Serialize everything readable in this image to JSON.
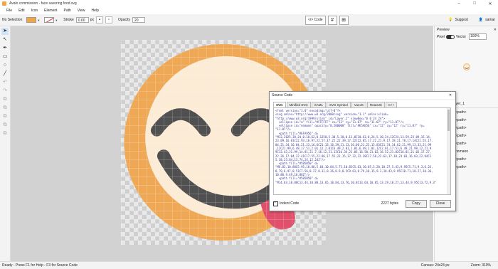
{
  "window": {
    "title": "Avalo commission - face savoring food.svg"
  },
  "menu": [
    "File",
    "Edit",
    "Icon",
    "Element",
    "Path",
    "View",
    "Help"
  ],
  "toolbar": {
    "selection": "No Selection",
    "stroke_label": "Stroke",
    "stroke_value": "0.00",
    "px": "px",
    "opacity_label": "Opacity",
    "opacity_value": "20",
    "code_label": "Code",
    "suggest_label": "Suggest",
    "user_label": "samar"
  },
  "preview": {
    "title": "Preview",
    "pixel_label": "Pixel",
    "vector_label": "Vector",
    "zoom": "100%"
  },
  "tree": {
    "header": "Layer_1",
    "rows": [
      "<path>",
      "<path>",
      "<path>",
      "<path>",
      "<path>",
      "nomano",
      "<path>",
      "<path>"
    ]
  },
  "dialog": {
    "title": "Source Code",
    "tabs": [
      "SVG",
      "Minified SVG",
      "XAML",
      "SVG Symbol",
      "VueJS",
      "ReactJS",
      "C++"
    ],
    "code_lines": [
      "<?xml version=\"1.0\" encoding=\"utf-8\"?>",
      "<svg xmlns=\"http://www.w3.org/2000/svg\" version=\"1.1\" xmlns:xlink=",
      "\"http://www.w3.org/1999/xlink\" id=\"Layer_1\" viewBox=\"0 0 24 24\">",
      "  <ellipse id=\"a\" fill=\"#FFFFFF\" cx=\"12\" cy=\"11.07\" rx=\"11.07\" ry=\"11.07\"/>",
      "  <ellipse id=\"nomano\" opacity=\"0.200000\" fill=\"#E5AE56\" cx=\"12\" cy=\"12\" rx=\"11.07\" ry=",
      "\"11.07\"/>",
      "  <path fill=\"#EFA956\" d=",
      "\"M12,2025.30,24,0.10,62,0.1250,5.30,5.30,0.12,0C10.62,0,24,5.30,24,12C24,13.59,23.09,15.14,",
      "23.09,16.01C22.93,16.97,22.57,17.22,22.39,17.22C22.85,17.22,21.9,17.19,21.78,17.14C21.55,17.",
      "04,21.34,16.84,21.23,16.6C21.13,16.39,21.13,16.06,21.23,15.83C21.74,14.62,21.99,13.33,21.99",
      ",12C21.99,6.49,17.51,2.01,12,2.01C6.49,2.01,2.01,6.49,2.01,12C2.01,17.51,6.49,21.99,12,21.9",
      "9C13.43,21.99,14.81,21.7,16.12,21.13C16.34,21.05,16.58,21.02,16.52,21.02C16.81,21.02,17.27,",
      "22.26,17.04,22.41C17.55,22.86,17.55,22.15,17.32,22.38C17.58,22.63,17.18,23.03,16.03,22.94C1",
      "5.38,23.64,13.74,24,12,24Z\"/>",
      "  <path fill=\"#505050\" d=",
      "\"M6.82,10.88C5.95,10.88,5.64,10.84,5.75,10.82C5.63,10.05,5.28,10.27,5.43,9.95C5.71,9.3,6.25,",
      "8.79,6.97,8.51C7.56,8.27,8.31,8.26,8.9,8.5C9.61,8.79,10.15,9.3,10.43,9.95C10.71,10.27,10.36,",
      "10.88,9.49,10.88Z\"/>",
      "  <path fill=\"#505050\" d=",
      "\"M14.03,10.88C13.44,10.88,13.65,10.84,13.76,10.8C13.64,10.05,13.29,10.27,13.44,9.95C13.72,9.3\""
    ],
    "indent_label": "Indent Code",
    "bytes": "2227 bytes",
    "copy_label": "Copy",
    "close_label": "Close"
  },
  "status": {
    "help": "Ready - Press F1 for Help - F3 for Source Code",
    "canvas": "Canvas: 24x24 px",
    "zoom": "Zoom: 310%"
  },
  "colors": {
    "face_fill": "#FCEBD5",
    "face_ring": "#EFA956",
    "features": "#505050",
    "tongue": "#E1506A"
  }
}
